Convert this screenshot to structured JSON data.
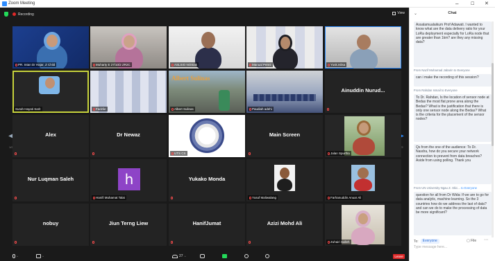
{
  "window": {
    "title": "Zoom Meeting",
    "controls": {
      "minimize": "–",
      "maximize": "☐",
      "close": "✕"
    }
  },
  "meeting": {
    "recording_label": "Recording",
    "view_label": "View",
    "page_left": "1/2",
    "page_right": "1/2",
    "tiles": [
      {
        "name": "PR. Intan Dr Hajar, Z Child",
        "kind": "video"
      },
      {
        "name": "Muharty  E 27/10/2 ZR2C",
        "kind": "video"
      },
      {
        "name": "ASLSIO NOSiak",
        "kind": "video"
      },
      {
        "name": "Manual Perez",
        "kind": "video"
      },
      {
        "name": "Yusk.Islisa",
        "kind": "video"
      },
      {
        "name": "Surah Hayati Sarit",
        "kind": "video"
      },
      {
        "name": "Fadzlie",
        "kind": "video"
      },
      {
        "name": "Albert Sulinas",
        "kind": "video",
        "overlay": "Albert Sulinas"
      },
      {
        "name": "Paudiah adehi",
        "kind": "video"
      },
      {
        "name": "Ainuddin  Nurud...",
        "kind": "name"
      },
      {
        "name": "Alex",
        "kind": "name"
      },
      {
        "name": "Dr Newaz",
        "kind": "name"
      },
      {
        "name": "UTS CS",
        "kind": "logo"
      },
      {
        "name": "Main Screen",
        "kind": "name"
      },
      {
        "name": "Jalan Spurtha",
        "kind": "video"
      },
      {
        "name": "Nur Luqman Saleh",
        "kind": "name"
      },
      {
        "name": "Hanifi Muhamat Talai",
        "kind": "avatar",
        "avatar_letter": "h"
      },
      {
        "name": "Yukako Monda",
        "kind": "name"
      },
      {
        "name": "Yusuf Maliwalang",
        "kind": "video"
      },
      {
        "name": "Farhanuddin Anuar Ali",
        "kind": "video"
      },
      {
        "name": "nobuy",
        "kind": "name"
      },
      {
        "name": "Jiun Terng Liew",
        "kind": "name"
      },
      {
        "name": "HanifJumat",
        "kind": "name"
      },
      {
        "name": "Azizi Mohd Ali",
        "kind": "name"
      },
      {
        "name": "Zuhairi Salleh",
        "kind": "video"
      }
    ]
  },
  "toolbar": {
    "unmute": "",
    "video": "",
    "participants": "27",
    "end": "Leave"
  },
  "chat": {
    "title": "Chat",
    "messages": [
      {
        "header": "",
        "to": "",
        "text": "Assalamualaikum Prof Adawati. I wanted to know what are the data delivery ratio for your LoRa deployment especially for LoRa node that are greater than 1km? are they any missing data?"
      },
      {
        "header": "From Nazif Mohamad Jabarin to Everyone",
        "to": "",
        "text": "can i make the recording of this session?"
      },
      {
        "header": "From Rahdan Ismail to Everyone",
        "to": "",
        "text": "To Dr. Rahdan, Is the location of sensor node at Bedas the most flat prone area along the Bedas? What is the justification that there is only one sensor node along the Bedas? What is the criteria for the placement of the sensor nodes?"
      },
      {
        "header": "",
        "to": "",
        "text": "Qs from the one of the audience: To Dr. Nasdra, how do you secure your network connection to prevent from data breaches? Aside from using polling. Thank you"
      },
      {
        "header": "From UN University Ngau Z. Skic...",
        "to": "to Everyone",
        "text": "question for all from Dr Wida: If we are to go for data analytic, machine learning. So the 3 countries how do we address the last of data? and can we do to make the processing of data be more significant?"
      }
    ],
    "to_label": "To:",
    "to_value": "Everyone",
    "file_label": "File",
    "input_placeholder": "Type message here..."
  }
}
